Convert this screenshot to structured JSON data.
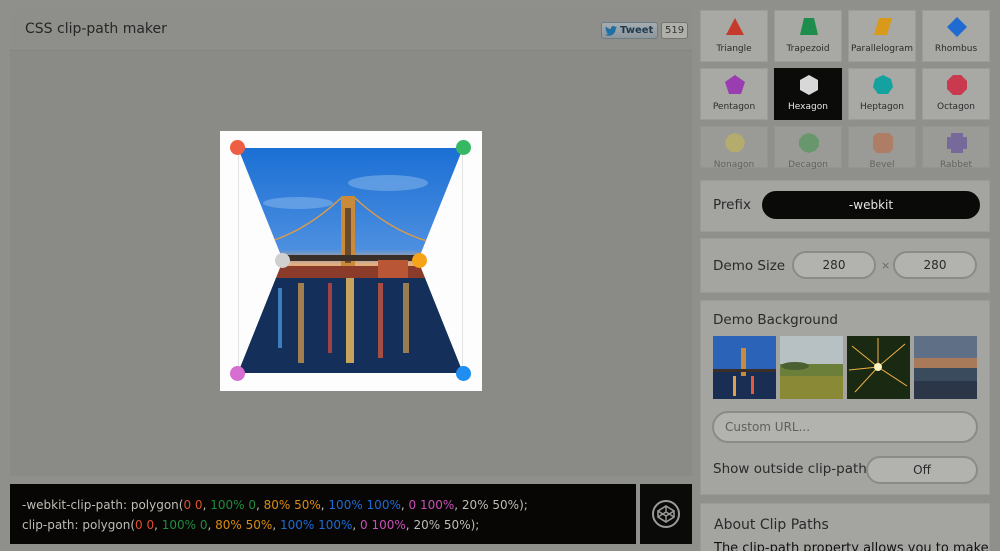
{
  "header": {
    "title": "CSS clip-path maker",
    "tweet_label": "Tweet",
    "tweet_count": "519"
  },
  "handles": [
    {
      "name": "handle-top-left",
      "color": "#ef5d43"
    },
    {
      "name": "handle-top-right",
      "color": "#36b862"
    },
    {
      "name": "handle-middle-left",
      "color": "#d0d0d0"
    },
    {
      "name": "handle-middle-right",
      "color": "#f5a318"
    },
    {
      "name": "handle-bottom-left",
      "color": "#d66ed1"
    },
    {
      "name": "handle-bottom-right",
      "color": "#1f8ef0"
    }
  ],
  "code": {
    "line1_prop": "-webkit-clip-path: ",
    "line2_prop": "clip-path: ",
    "fn_open": "polygon(",
    "p1": "0 0",
    "p2": "100% 0",
    "p3": "80% 50%",
    "p4": "100% 100%",
    "p5": "0 100%",
    "p6": "20% 50%",
    "sep": ", ",
    "fn_close": ");"
  },
  "shapes": [
    {
      "label": "Triangle",
      "icon": "triangle-icon",
      "color": "#c63a2c"
    },
    {
      "label": "Trapezoid",
      "icon": "trapezoid-icon",
      "color": "#1c8d4a"
    },
    {
      "label": "Parallelogram",
      "icon": "parallelogram-icon",
      "color": "#d99a19"
    },
    {
      "label": "Rhombus",
      "icon": "rhombus-icon",
      "color": "#1f6bd1"
    },
    {
      "label": "Pentagon",
      "icon": "pentagon-icon",
      "color": "#9a3db1"
    },
    {
      "label": "Hexagon",
      "icon": "hexagon-icon",
      "color": "#d8d8d8"
    },
    {
      "label": "Heptagon",
      "icon": "heptagon-icon",
      "color": "#14a2a0"
    },
    {
      "label": "Octagon",
      "icon": "octagon-icon",
      "color": "#c93a4f"
    },
    {
      "label": "Nonagon",
      "icon": "nonagon-icon",
      "color": "#e2d04a"
    },
    {
      "label": "Decagon",
      "icon": "decagon-icon",
      "color": "#3aa24a"
    },
    {
      "label": "Bevel",
      "icon": "bevel-icon",
      "color": "#d4693a"
    },
    {
      "label": "Rabbet",
      "icon": "rabbet-icon",
      "color": "#5b3fb0"
    }
  ],
  "prefix": {
    "label": "Prefix",
    "value": "-webkit"
  },
  "demo_size": {
    "label": "Demo Size",
    "width": "280",
    "times": "×",
    "height": "280"
  },
  "demo_background": {
    "label": "Demo Background",
    "url_placeholder": "Custom URL..."
  },
  "outside": {
    "label": "Show outside clip-path",
    "value": "Off"
  },
  "about": {
    "title": "About Clip Paths",
    "text": "The clip-path property allows you to make"
  }
}
